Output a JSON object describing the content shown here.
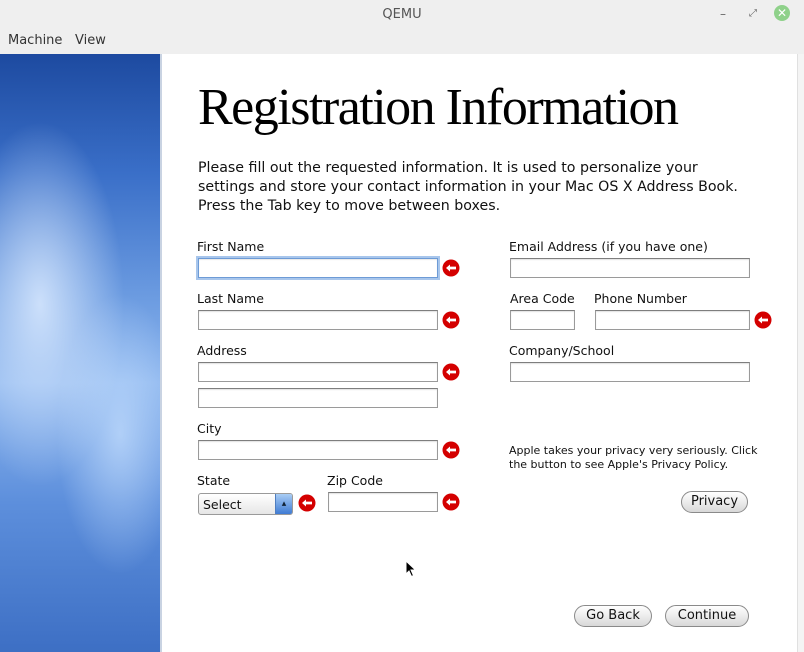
{
  "window": {
    "title": "QEMU",
    "controls": {
      "minimize": "minimize-icon",
      "maximize": "maximize-icon",
      "close": "close-icon"
    }
  },
  "menubar": {
    "items": [
      "Machine",
      "View"
    ]
  },
  "content": {
    "title": "Registration Information",
    "intro": "Please fill out the requested information. It is used to personalize your settings and store your contact information in your Mac OS X Address Book. Press the Tab key to move between boxes.",
    "labels": {
      "first_name": "First Name",
      "last_name": "Last Name",
      "address": "Address",
      "city": "City",
      "state": "State",
      "zip": "Zip Code",
      "email": "Email Address (if you have one)",
      "area_code": "Area Code",
      "phone": "Phone Number",
      "company": "Company/School"
    },
    "values": {
      "first_name": "",
      "last_name": "",
      "address_1": "",
      "address_2": "",
      "city": "",
      "zip": "",
      "email": "",
      "area_code": "",
      "phone": "",
      "company": ""
    },
    "state_select": {
      "selected": "Select"
    },
    "privacy": {
      "text": "Apple takes your privacy very seriously. Click the button to see Apple's Privacy Policy.",
      "button": "Privacy"
    },
    "buttons": {
      "back": "Go Back",
      "continue": "Continue"
    }
  },
  "colors": {
    "required_indicator": "#d40000",
    "focus_ring": "#a8c6ec",
    "sidebar_blue": "#3a6fc8"
  }
}
